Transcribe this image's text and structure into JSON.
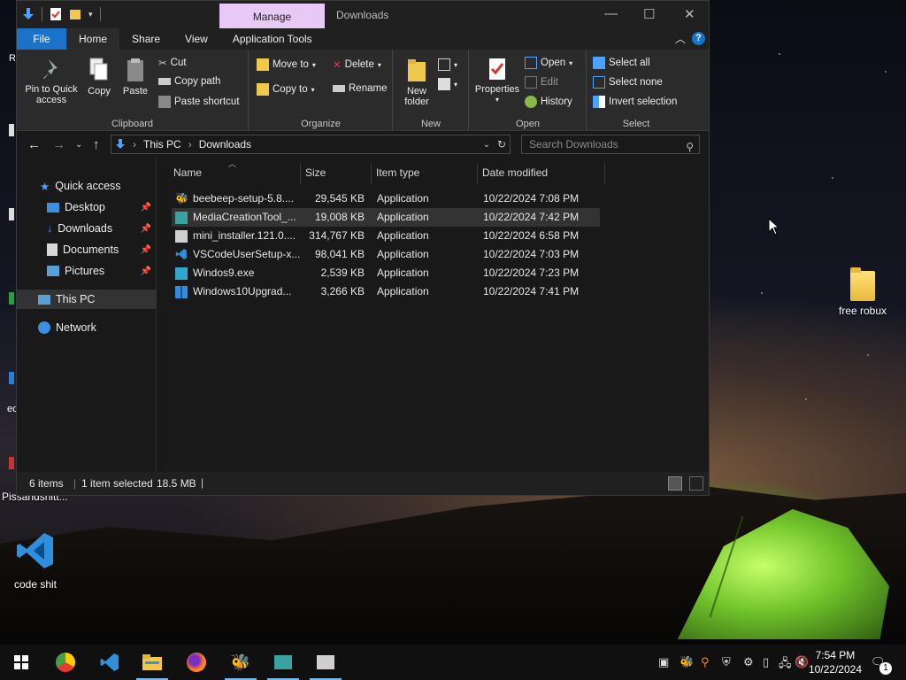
{
  "desktop": {
    "icons": [
      {
        "label": "free robux"
      },
      {
        "label": "code shit"
      },
      {
        "label": "Pissandshitt..."
      }
    ]
  },
  "window": {
    "context_tab": "Manage",
    "title": "Downloads",
    "menu": {
      "file": "File",
      "home": "Home",
      "share": "Share",
      "view": "View",
      "app_tools": "Application Tools"
    },
    "ribbon": {
      "clipboard": {
        "label": "Clipboard",
        "pin": "Pin to Quick access",
        "copy": "Copy",
        "paste": "Paste",
        "cut": "Cut",
        "copy_path": "Copy path",
        "paste_shortcut": "Paste shortcut"
      },
      "organize": {
        "label": "Organize",
        "move_to": "Move to",
        "copy_to": "Copy to",
        "delete": "Delete",
        "rename": "Rename"
      },
      "new": {
        "label": "New",
        "new_folder": "New folder"
      },
      "open": {
        "label": "Open",
        "properties": "Properties",
        "open": "Open",
        "edit": "Edit",
        "history": "History"
      },
      "select": {
        "label": "Select",
        "select_all": "Select all",
        "select_none": "Select none",
        "invert": "Invert selection"
      }
    },
    "address": {
      "root": "This PC",
      "current": "Downloads"
    },
    "search": {
      "placeholder": "Search Downloads"
    },
    "nav": {
      "quick_access": "Quick access",
      "items": [
        "Desktop",
        "Downloads",
        "Documents",
        "Pictures"
      ],
      "this_pc": "This PC",
      "network": "Network"
    },
    "columns": {
      "name": "Name",
      "size": "Size",
      "type": "Item type",
      "date": "Date modified"
    },
    "files": [
      {
        "name": "beebeep-setup-5.8....",
        "size": "29,545 KB",
        "type": "Application",
        "date": "10/22/2024 7:08 PM"
      },
      {
        "name": "MediaCreationTool_...",
        "size": "19,008 KB",
        "type": "Application",
        "date": "10/22/2024 7:42 PM"
      },
      {
        "name": "mini_installer.121.0....",
        "size": "314,767 KB",
        "type": "Application",
        "date": "10/22/2024 6:58 PM"
      },
      {
        "name": "VSCodeUserSetup-x...",
        "size": "98,041 KB",
        "type": "Application",
        "date": "10/22/2024 7:03 PM"
      },
      {
        "name": "Windos9.exe",
        "size": "2,539 KB",
        "type": "Application",
        "date": "10/22/2024 7:23 PM"
      },
      {
        "name": "Windows10Upgrad...",
        "size": "3,266 KB",
        "type": "Application",
        "date": "10/22/2024 7:41 PM"
      }
    ],
    "status": {
      "count": "6 items",
      "selected": "1 item selected",
      "size": "18.5 MB"
    }
  },
  "taskbar": {
    "time": "7:54 PM",
    "date": "10/22/2024",
    "notification_count": "1"
  },
  "colors": {
    "accent": "#1a73c9",
    "context_tab": "#e8c8f5",
    "window_bg": "#191919",
    "ribbon_bg": "#2b2b2b"
  }
}
